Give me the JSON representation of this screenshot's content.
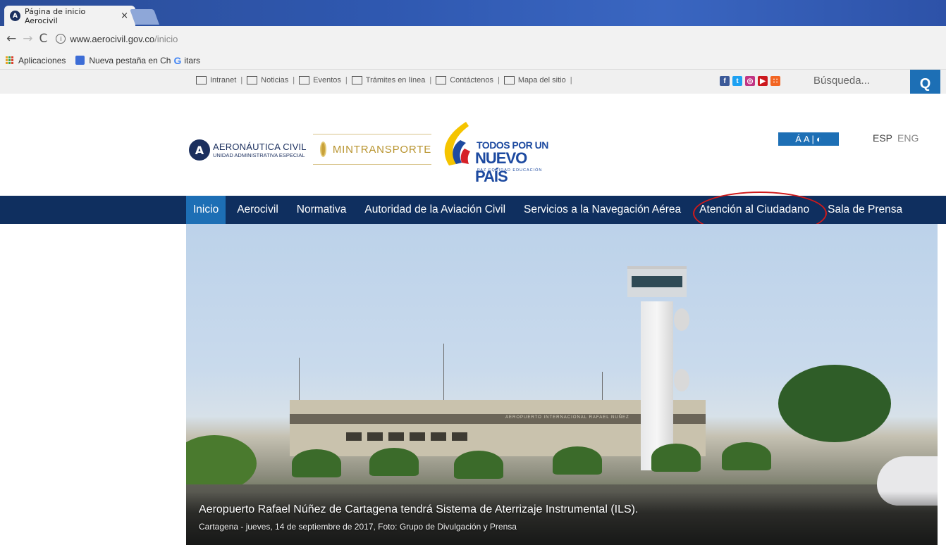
{
  "browser": {
    "tab_title": "Página de inicio Aerocivil",
    "tab_close": "×",
    "url_host": "www.aerocivil.gov.co",
    "url_path": "/inicio",
    "bookmarks": [
      "Aplicaciones",
      "Nueva pestaña en Ch",
      "itars"
    ]
  },
  "utility": {
    "links": [
      {
        "label": "Intranet",
        "icon": "intranet-icon"
      },
      {
        "label": "Noticias",
        "icon": "news-icon"
      },
      {
        "label": "Eventos",
        "icon": "calendar-icon"
      },
      {
        "label": "Trámites en línea",
        "icon": "monitor-icon"
      },
      {
        "label": "Contáctenos",
        "icon": "envelope-icon"
      },
      {
        "label": "Mapa del sitio",
        "icon": "sitemap-icon"
      }
    ],
    "separator": "|",
    "social": [
      {
        "name": "facebook-icon",
        "glyph": "f",
        "color": "#3b5998"
      },
      {
        "name": "twitter-icon",
        "glyph": "t",
        "color": "#1da1f2"
      },
      {
        "name": "instagram-icon",
        "glyph": "◎",
        "color": "#c13584"
      },
      {
        "name": "youtube-icon",
        "glyph": "▶",
        "color": "#cc181e"
      },
      {
        "name": "rss-icon",
        "glyph": "∷",
        "color": "#f26522"
      }
    ],
    "search_placeholder": "Búsqueda...",
    "search_glyph": "Q"
  },
  "header": {
    "aero_line1": "AERONÁUTICA CIVIL",
    "aero_line2": "UNIDAD ADMINISTRATIVA ESPECIAL",
    "mint": "MINTRANSPORTE",
    "tpp_line1": "TODOS POR UN",
    "tpp_line2": "NUEVO PAÍS",
    "tpp_line3": "PAZ EQUIDAD EDUCACIÓN",
    "a11y": {
      "a_big": "Á",
      "a_small": "A",
      "sep": "|",
      "contrast": "◐"
    },
    "lang_esp": "ESP",
    "lang_eng": "ENG"
  },
  "nav": {
    "items": [
      "Inicio",
      "Aerocivil",
      "Normativa",
      "Autoridad de la Aviación Civil",
      "Servicios a la Navegación Aérea",
      "Atención al Ciudadano",
      "Sala de Prensa"
    ],
    "active_index": 0,
    "highlighted_index": 5
  },
  "hero": {
    "title": "Aeropuerto Rafael Núñez de Cartagena tendrá Sistema de Aterrizaje Instrumental (ILS).",
    "subtitle": "Cartagena - jueves, 14 de septiembre de 2017, Foto: Grupo de Divulgación y Prensa",
    "building_sign": "AEROPUERTO INTERNACIONAL RAFAEL NUÑEZ"
  },
  "colors": {
    "nav_bg": "#0f2f5f",
    "accent_blue": "#1d6fb5",
    "highlight_red": "#d11a1a"
  }
}
